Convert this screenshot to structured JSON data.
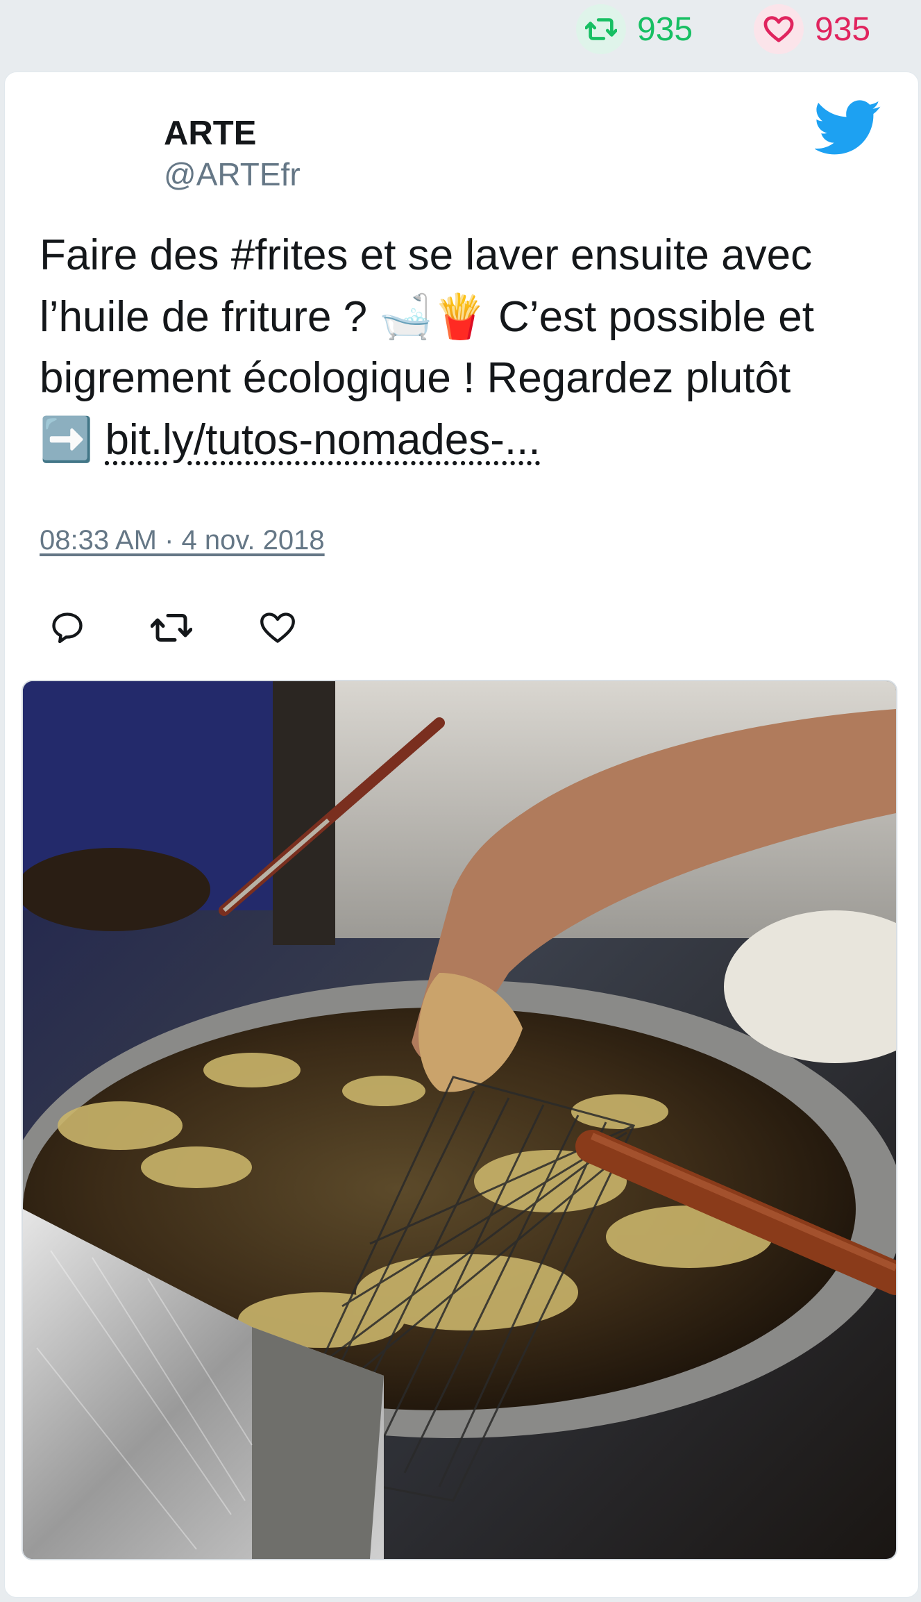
{
  "top_stats": {
    "retweet_count": "935",
    "like_count": "935"
  },
  "tweet": {
    "author_name": "ARTE",
    "author_handle": "@ARTEfr",
    "text_line_1": "Faire des #frites et se laver ensuite avec",
    "text_line_2_start": "l’huile de friture ?",
    "text_line_2_emoji": "🛁🍟",
    "text_line_2_end": "C’est possible et",
    "text_line_3": "bigrement écologique ! Regardez plutôt",
    "arrow_emoji": "➡️",
    "link_text": "bit.ly/tutos-nomades-...",
    "timestamp": "08:33 AM · 4 nov. 2018"
  },
  "icons": {
    "stat_retweet": "retweet-icon",
    "stat_like": "heart-icon",
    "brand": "twitter-bird-icon",
    "reply": "reply-icon",
    "retweet": "retweet-icon",
    "like": "heart-icon"
  },
  "colors": {
    "retweet_green": "#17bf63",
    "like_red": "#e0245e",
    "twitter_blue": "#1da1f2",
    "muted_text": "#657786",
    "card_bg": "#ffffff",
    "page_bg": "#e8ecef"
  },
  "media": {
    "alt": "photo"
  }
}
